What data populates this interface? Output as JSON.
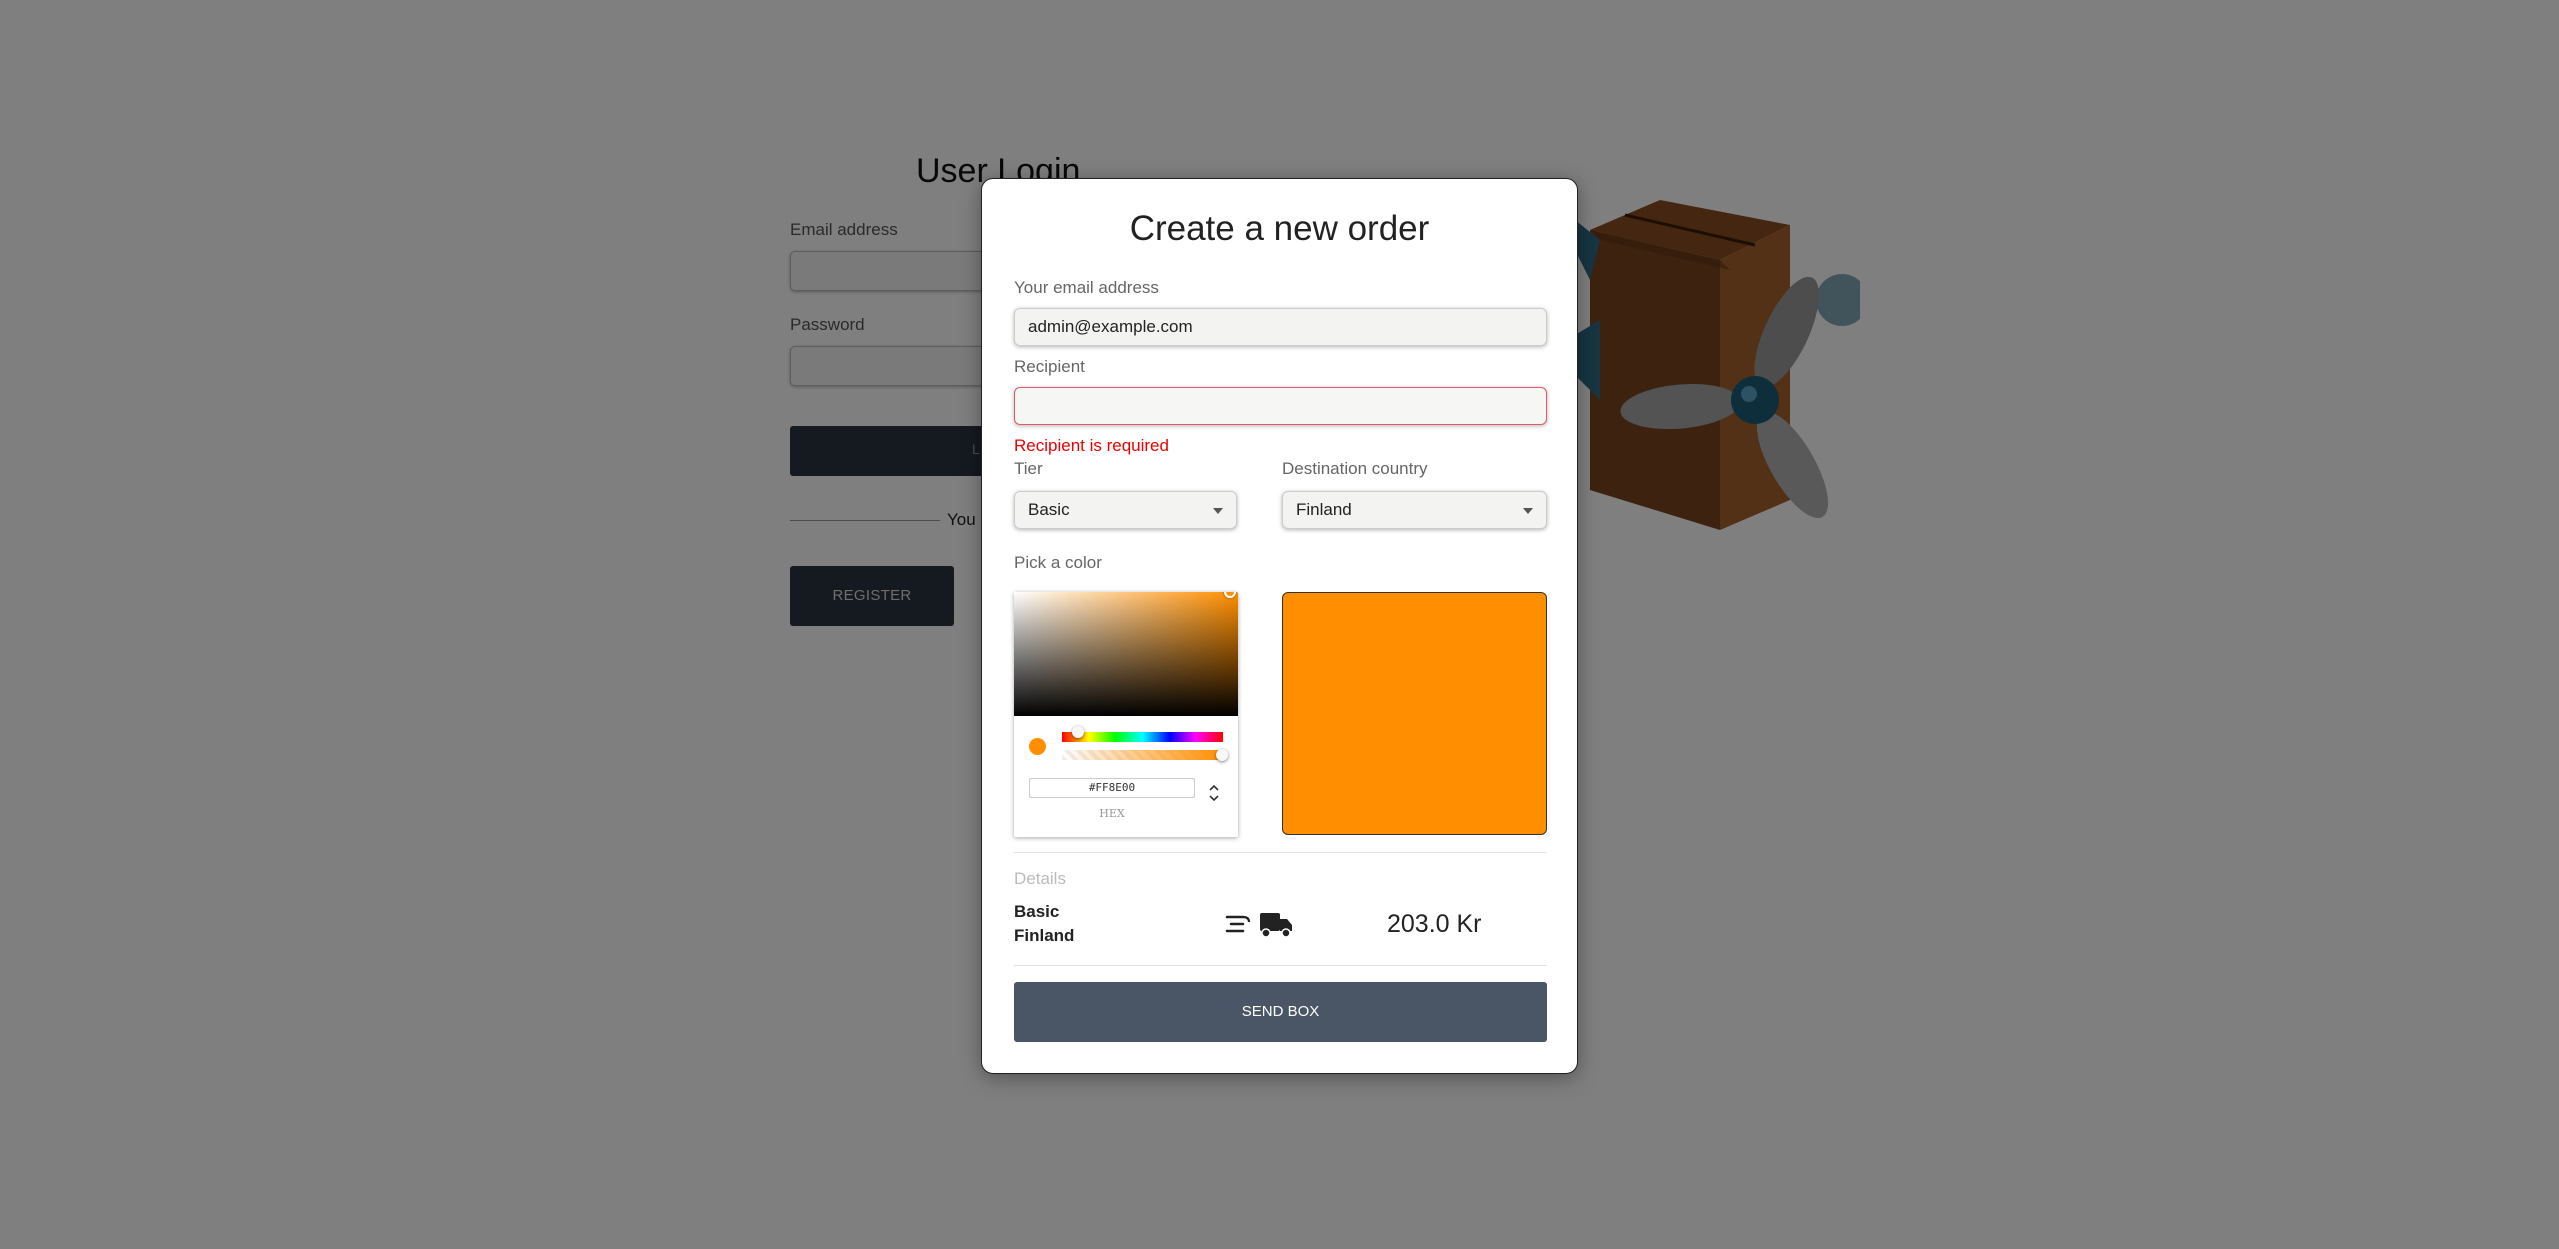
{
  "background_page": {
    "title": "User Login",
    "email_label": "Email address",
    "password_label": "Password",
    "login_button_partial": "L",
    "divider_text": "You",
    "register_label": "REGISTER"
  },
  "modal": {
    "title": "Create a new order",
    "email": {
      "label": "Your email address",
      "value": "admin@example.com"
    },
    "recipient": {
      "label": "Recipient",
      "value": "",
      "error": "Recipient is required"
    },
    "tier": {
      "label": "Tier",
      "selected": "Basic"
    },
    "destination": {
      "label": "Destination country",
      "selected": "Finland"
    },
    "color": {
      "label": "Pick a color",
      "hex": "#FF8E00",
      "format_label": "HEX",
      "value": "#ff8e00"
    },
    "details": {
      "label": "Details",
      "tier": "Basic",
      "country": "Finland",
      "shipping_icon": "fast-delivery-truck-icon",
      "price": "203.0 Kr"
    },
    "send_button": "SEND BOX"
  }
}
